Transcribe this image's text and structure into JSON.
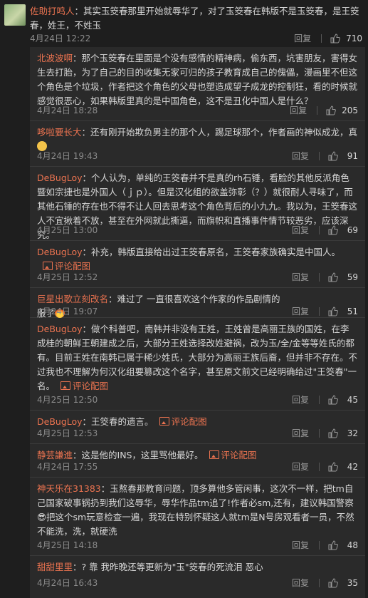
{
  "main_comment": {
    "username": "佐助打鸣人",
    "text": "：其实玉筊春那里开始就辱华了，对了玉筊春在韩版不是玉筊春，是王筊春，姓王，不姓玉",
    "time": "4月24日 12:22",
    "reply_label": "回复",
    "likes": "710"
  },
  "replies": [
    {
      "username": "北波波啊",
      "text": "：那个玉筊春在里面是个没有感情的精神病，偷东西，坑害朋友，害得女生去打胎，为了自己的目的收集无家可归的孩子教育成自己的傀儡，漫画里不但这个角色是个垃圾，作者把这个角色的父母也塑造成望子成龙的控制狂，看的时候就感觉很恶心，如果韩版里真的是中国角色，这不是丑化中国人是什么？",
      "time": "4月24日 18:28",
      "reply_label": "回复",
      "likes": "205"
    },
    {
      "username": "哆啦要长大",
      "text": "：还有刚开始欺负男主的那个人，踢足球那个，作者画的神似成龙，真",
      "emoji": "face-emoji",
      "time": "4月24日 19:43",
      "reply_label": "回复",
      "likes": "91"
    },
    {
      "username": "DeBugLoy",
      "text": "：个人认为，单纯的王筊春并不是真的rh石锤，看脸的其他反派角色暨如宗捷也是外国人（ｊｐ）。但是汉化组的欲盖弥彰（？）就很耐人寻味了，而其他石锤的存在也不得不让人回去思考这个角色背后的小九九。我以为，王筊春这人不宜揪着不放，甚至在外网就此撕逼，而旗帜和直播事件情节较恶劣，应该深究。",
      "time": "4月25日 13:00",
      "reply_label": "回复",
      "likes": "69"
    },
    {
      "username": "DeBugLoy",
      "text": "：补充，韩版直接给出过王筊春原名，王筊春家族确实是中国人。",
      "pic_label": "评论配图",
      "time": "4月25日 12:52",
      "reply_label": "回复",
      "likes": "59"
    },
    {
      "username": "巨星出歌立刻改名",
      "text": "：难过了 一直很喜欢这个作家的作品剧情的 服了",
      "emoji": "fire-emoji",
      "time": "4月24日 19:07",
      "reply_label": "回复",
      "likes": "51"
    },
    {
      "username": "DeBugLoy",
      "text": "：做个科普吧，南韩并非没有王姓，王姓曾是高丽王族的国姓，在李成桂的朝鲜王朝建成之后，大部分王姓选择改姓避祸，改为玉/全/金等等姓氏的都有。目前王姓在南韩已属于稀少姓氏，大部分为高丽王族后裔，但并非不存在。不过我也不理解为何汉化组要篡改这个名字，甚至原文前文已经明确给过\"王筊春\"一名。",
      "pic_label": "评论配图",
      "time": "4月25日 12:50",
      "reply_label": "回复",
      "likes": "45"
    },
    {
      "username": "DeBugLoy",
      "text": "：王筊春的遗言。",
      "pic_label": "评论配图",
      "time": "4月25日 12:53",
      "reply_label": "回复",
      "likes": "32"
    },
    {
      "username": "静芸謙進",
      "text": "：这是他的INS，这里骂他最好。",
      "pic_label": "评论配图",
      "time": "4月24日 17:55",
      "reply_label": "回复",
      "likes": "42"
    },
    {
      "username": "神天乐在31383",
      "text": "：玉熬春那教育问题，顶多算他多管闲事，这次不一样，把tm自己国家破事锅扔到我们这辱华，辱华作品tm追了!作者必sm,还有，建议韩国警察😎把这个sm玩意检查一遍，我现在特别怀疑这人就tm是N号房观看者一员，不然不能洗，洗，就硬洗",
      "time": "4月25日 14:18",
      "reply_label": "回复",
      "likes": "48"
    },
    {
      "username": "甜甜里里",
      "text": "：? 靠 我昨晚还等更新为\"玉\"筊春的死流泪 恶心",
      "time": "4月24日 16:43",
      "reply_label": "回复",
      "likes": "35"
    }
  ],
  "colors": {
    "username": "#eb7350",
    "background": "#1e1e1e",
    "reply_panel": "#2a2a2a",
    "text": "#d6d6d6",
    "meta": "#8b8b8b"
  }
}
